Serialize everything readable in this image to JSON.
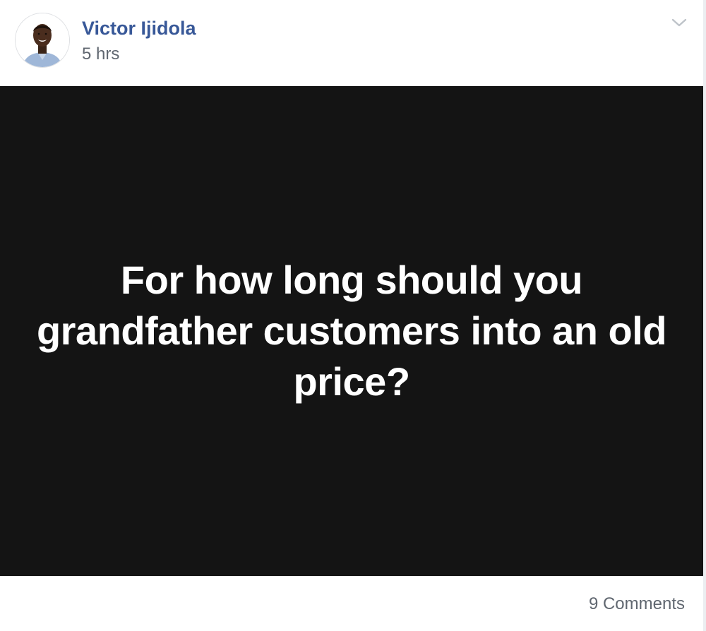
{
  "post": {
    "author": {
      "name": "Victor Ijidola",
      "avatar_icon": "user-avatar-photo"
    },
    "timestamp": "5 hrs",
    "options_icon": "chevron-down-icon",
    "media": {
      "background_color": "#141414",
      "text": "For how long should you grandfather customers into an old price?"
    },
    "footer": {
      "comments_label": "9 Comments"
    }
  },
  "colors": {
    "author_link": "#385898",
    "secondary_text": "#606770",
    "media_text": "#ffffff"
  }
}
